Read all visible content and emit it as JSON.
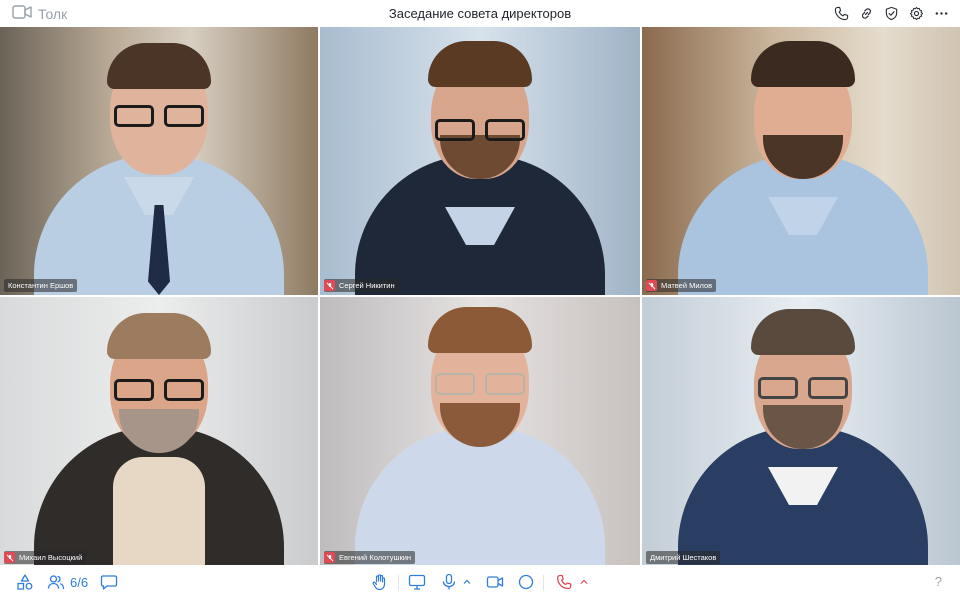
{
  "app": {
    "name": "Толк"
  },
  "meeting": {
    "title": "Заседание совета директоров"
  },
  "top_actions": [
    {
      "icon": "phone-icon"
    },
    {
      "icon": "link-icon"
    },
    {
      "icon": "shield-check-icon"
    },
    {
      "icon": "gear-icon"
    },
    {
      "icon": "more-icon"
    }
  ],
  "participants": [
    {
      "name": "Константин Ершов",
      "muted": false,
      "active": true
    },
    {
      "name": "Сергей Никитин",
      "muted": true,
      "active": false
    },
    {
      "name": "Матвей Милов",
      "muted": true,
      "active": false
    },
    {
      "name": "Михаил Высоцкий",
      "muted": true,
      "active": false
    },
    {
      "name": "Евгений Колотушкин",
      "muted": true,
      "active": false
    },
    {
      "name": "Дмитрий Шестаков",
      "muted": false,
      "active": false
    }
  ],
  "toolbar": {
    "participants_count": "6/6",
    "help": "?"
  },
  "colors": {
    "accent": "#2f7de1",
    "active_border": "#2f80ff",
    "mute_badge": "#e04a55"
  }
}
